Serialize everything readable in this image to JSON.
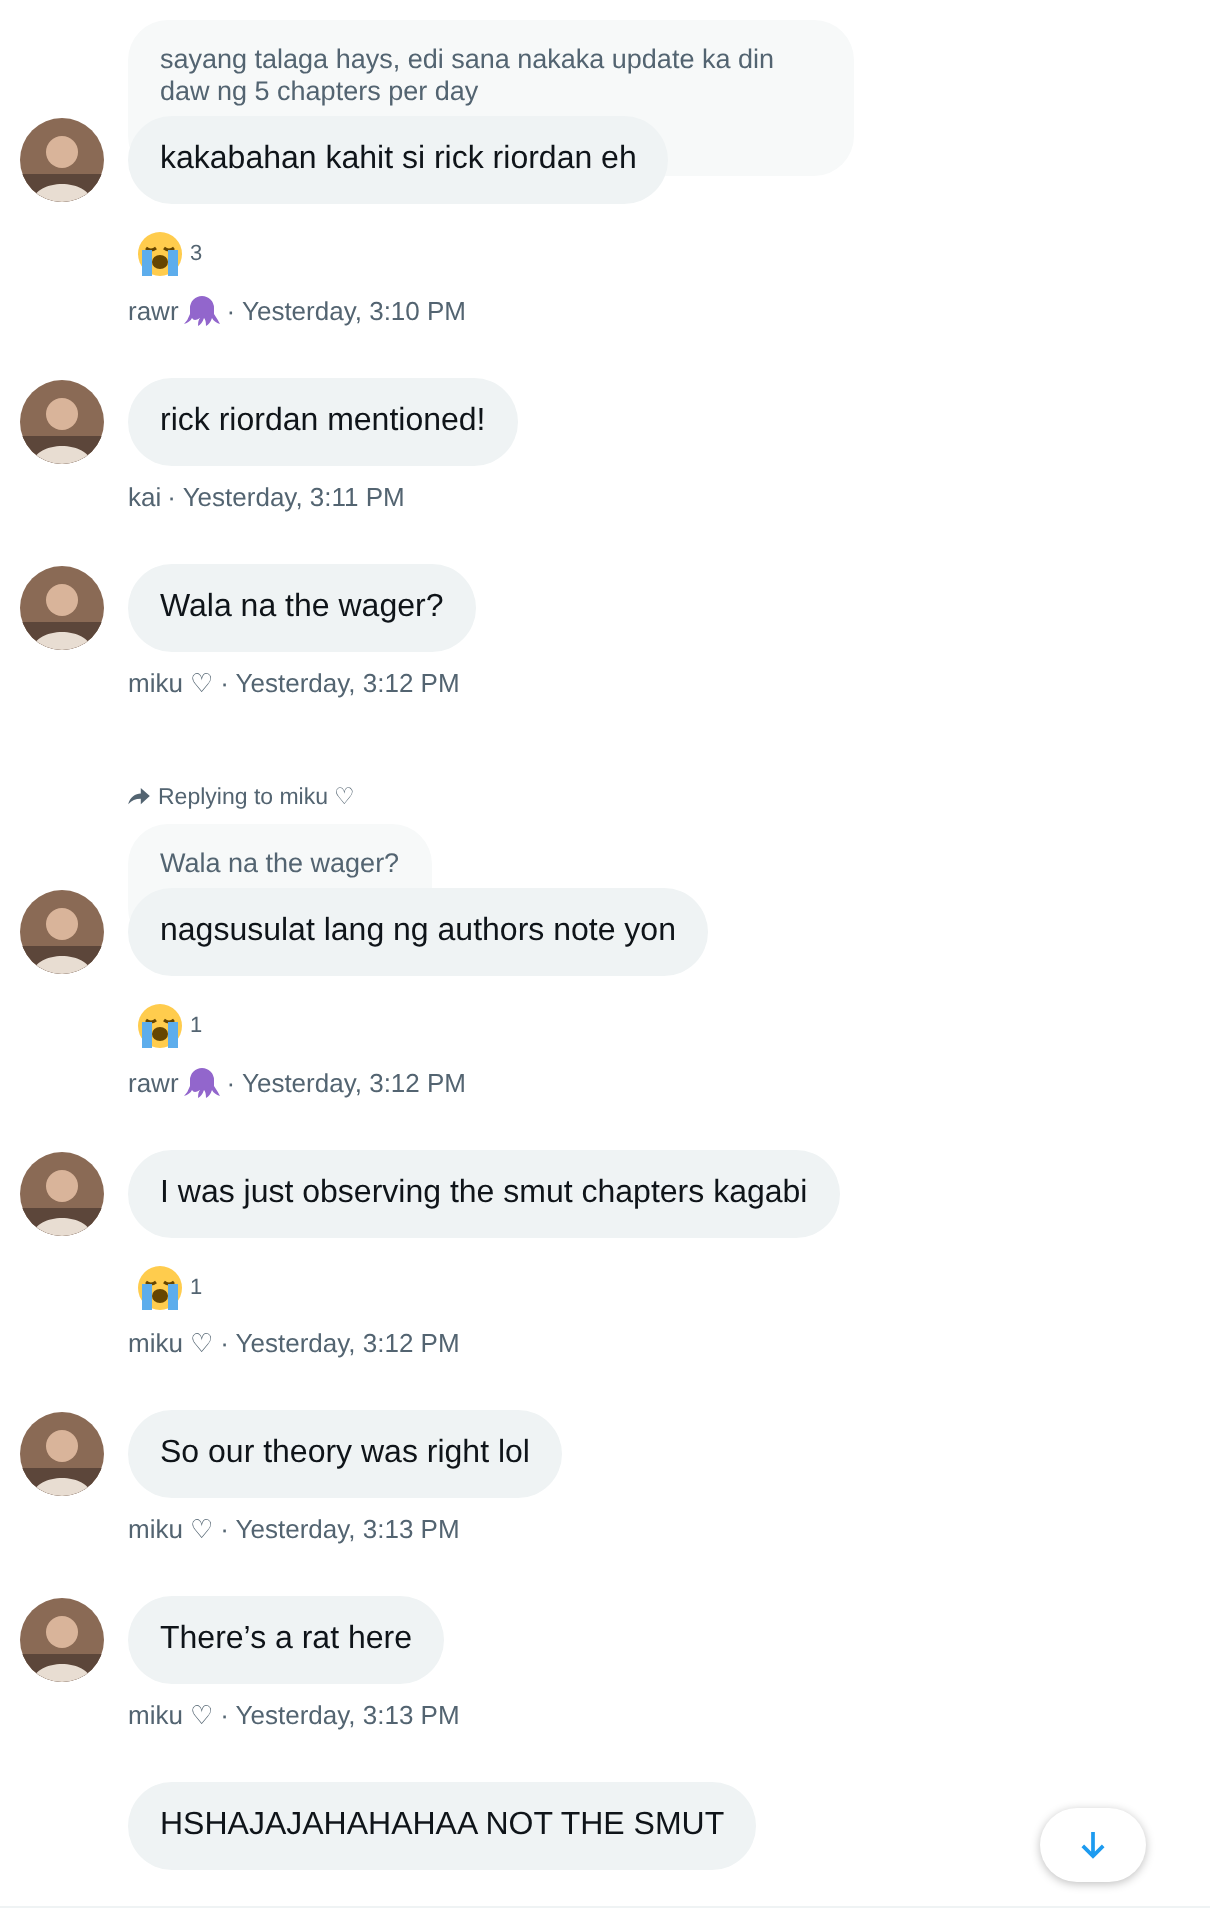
{
  "messages": [
    {
      "avatar": true,
      "quote": "sayang talaga hays, edi sana nakaka update ka din daw ng 5 chapters per day",
      "text": "kakabahan kahit si rick riordan eh",
      "reaction_count": "3",
      "author": "rawr",
      "author_badge": true,
      "time": "· Yesterday, 3:10 PM"
    },
    {
      "avatar": true,
      "text": "rick riordan mentioned!",
      "author": "kai",
      "author_badge": false,
      "time": "· Yesterday, 3:11 PM"
    },
    {
      "avatar": true,
      "text": "Wala na the wager?",
      "author": "miku ♡",
      "author_badge": false,
      "time": "· Yesterday, 3:12 PM"
    },
    {
      "avatar": true,
      "replying_to": "Replying to miku ♡",
      "quote": "Wala na the wager?",
      "text": "nagsusulat lang ng authors note yon",
      "reaction_count": "1",
      "author": "rawr",
      "author_badge": true,
      "time": "· Yesterday, 3:12 PM"
    },
    {
      "avatar": true,
      "text": "I was just observing the smut chapters kagabi",
      "reaction_count": "1",
      "author": "miku ♡",
      "author_badge": false,
      "time": "· Yesterday, 3:12 PM"
    },
    {
      "avatar": true,
      "text": "So our theory was right lol",
      "author": "miku ♡",
      "author_badge": false,
      "time": "· Yesterday, 3:13 PM"
    },
    {
      "avatar": true,
      "text": "There’s a rat here",
      "author": "miku ♡",
      "author_badge": false,
      "time": "· Yesterday, 3:13 PM"
    },
    {
      "avatar": false,
      "text": "HSHAJAJAHAHAHAA NOT THE SMUT"
    }
  ],
  "scroll_down_button": true
}
